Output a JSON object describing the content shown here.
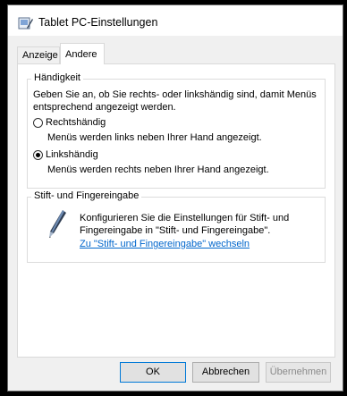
{
  "window": {
    "title": "Tablet PC-Einstellungen"
  },
  "tabs": [
    {
      "label": "Anzeige",
      "active": false
    },
    {
      "label": "Andere",
      "active": true
    }
  ],
  "handedness": {
    "title": "Händigkeit",
    "description_line1": "Geben Sie an, ob Sie rechts- oder linkshändig sind, damit Menüs",
    "description_line2": "entsprechend angezeigt werden.",
    "options": [
      {
        "label": "Rechtshändig",
        "desc": "Menüs werden links neben Ihrer Hand angezeigt.",
        "checked": false
      },
      {
        "label": "Linkshändig",
        "desc": "Menüs werden rechts neben Ihrer Hand angezeigt.",
        "checked": true
      }
    ]
  },
  "pen": {
    "title": "Stift- und Fingereingabe",
    "text_line1": "Konfigurieren Sie die Einstellungen für Stift- und",
    "text_line2": "Fingereingabe in \"Stift- und Fingereingabe\".",
    "link": "Zu \"Stift- und Fingereingabe\" wechseln",
    "icon": "pen-icon"
  },
  "buttons": {
    "ok": "OK",
    "cancel": "Abbrechen",
    "apply": "Übernehmen"
  },
  "colors": {
    "link": "#0066cc",
    "default_button_border": "#0078d7"
  }
}
